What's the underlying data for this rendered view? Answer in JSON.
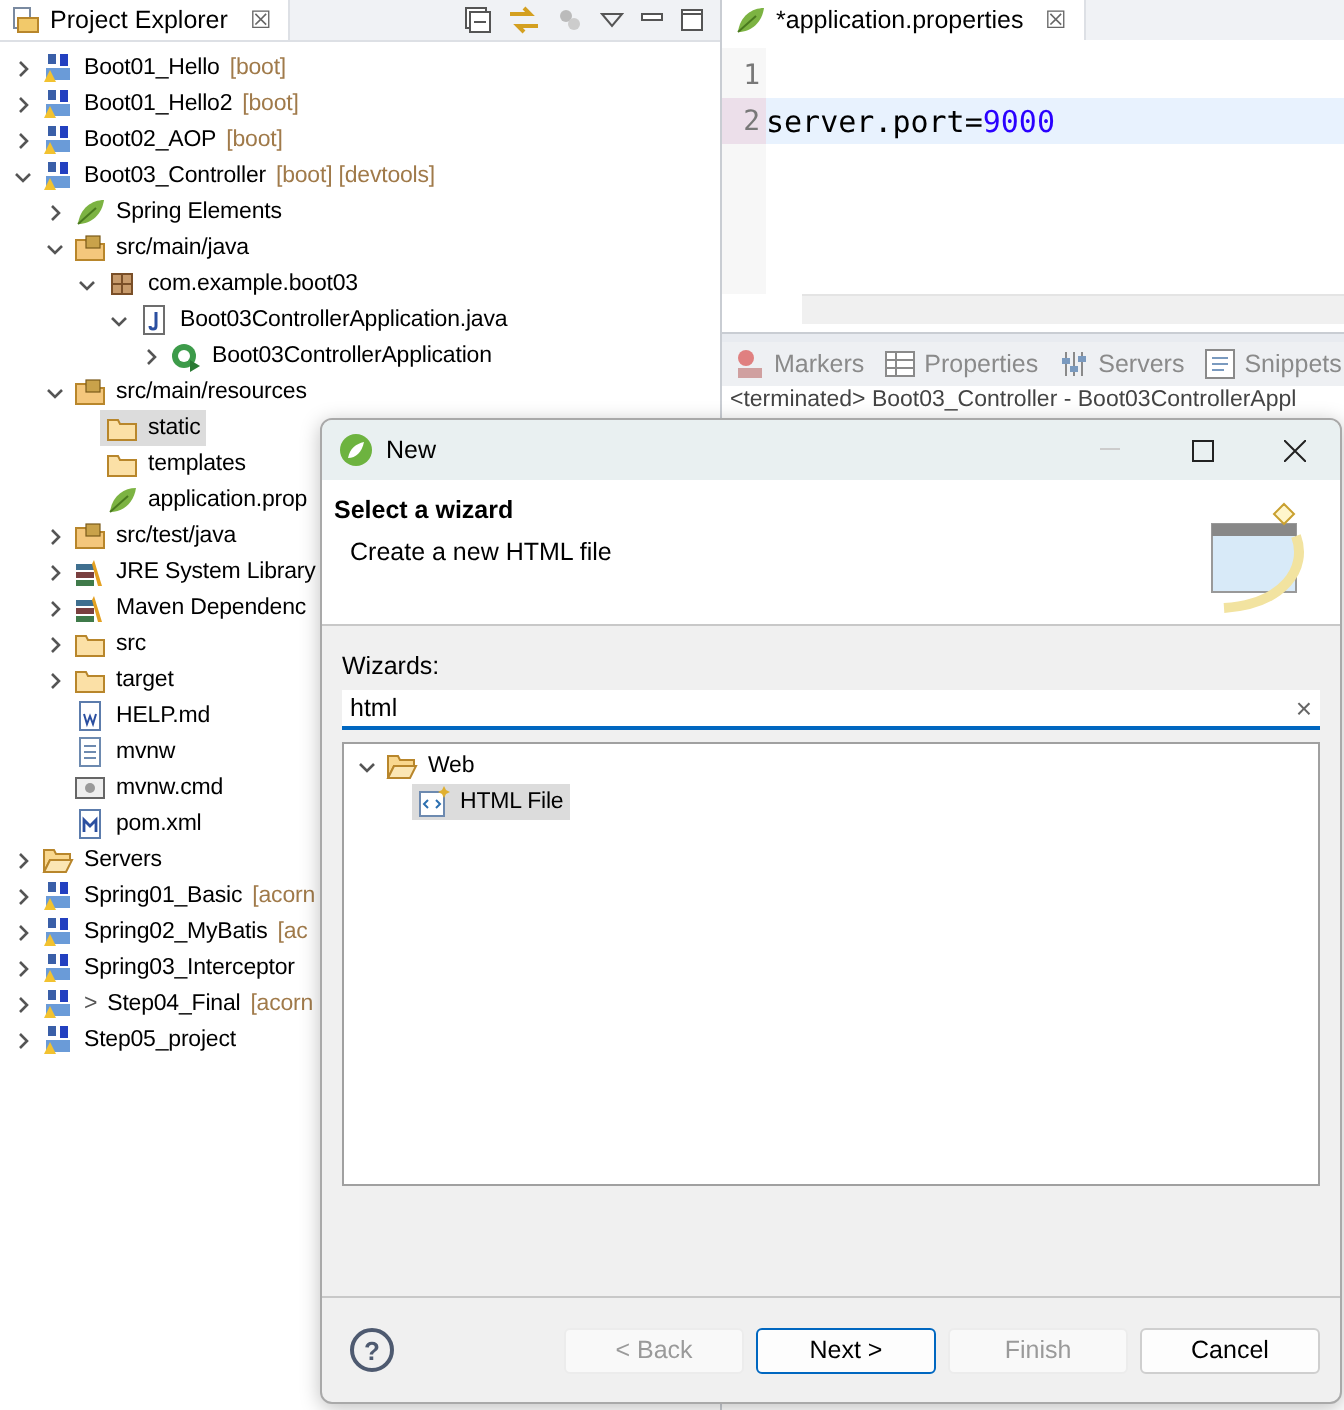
{
  "explorer": {
    "title": "Project Explorer",
    "close": "☒",
    "tree": [
      {
        "label": "Boot01_Hello",
        "tag": "[boot]",
        "kind": "project",
        "expanded": false,
        "selected": false
      },
      {
        "label": "Boot01_Hello2",
        "tag": "[boot]",
        "kind": "project",
        "expanded": false,
        "selected": false
      },
      {
        "label": "Boot02_AOP",
        "tag": "[boot]",
        "kind": "project",
        "expanded": false,
        "selected": false
      },
      {
        "label": "Boot03_Controller",
        "tag": "[boot] [devtools]",
        "kind": "project",
        "expanded": true,
        "selected": false,
        "children": [
          {
            "label": "Spring Elements",
            "kind": "spring",
            "expanded": false,
            "selected": false
          },
          {
            "label": "src/main/java",
            "kind": "srcfolder",
            "expanded": true,
            "selected": false,
            "children": [
              {
                "label": "com.example.boot03",
                "kind": "package",
                "expanded": true,
                "selected": false,
                "children": [
                  {
                    "label": "Boot03ControllerApplication.java",
                    "kind": "javafile",
                    "expanded": true,
                    "selected": false,
                    "children": [
                      {
                        "label": "Boot03ControllerApplication",
                        "kind": "class",
                        "expanded": false,
                        "selected": false
                      }
                    ]
                  }
                ]
              }
            ]
          },
          {
            "label": "src/main/resources",
            "kind": "srcfolder",
            "expanded": true,
            "selected": false,
            "children": [
              {
                "label": "static",
                "kind": "folder",
                "selected": true
              },
              {
                "label": "templates",
                "kind": "folder",
                "selected": false
              },
              {
                "label": "application.prop",
                "kind": "spring",
                "selected": false
              }
            ]
          },
          {
            "label": "src/test/java",
            "kind": "srcfolder",
            "expanded": false,
            "selected": false
          },
          {
            "label": "JRE System Library",
            "kind": "library",
            "expanded": false,
            "selected": false
          },
          {
            "label": "Maven Dependenc",
            "kind": "library",
            "expanded": false,
            "selected": false
          },
          {
            "label": "src",
            "kind": "folder",
            "expanded": false,
            "selected": false
          },
          {
            "label": "target",
            "kind": "folder",
            "expanded": false,
            "selected": false
          },
          {
            "label": "HELP.md",
            "kind": "docfile",
            "selected": false
          },
          {
            "label": "mvnw",
            "kind": "textfile",
            "selected": false
          },
          {
            "label": "mvnw.cmd",
            "kind": "cmdfile",
            "selected": false
          },
          {
            "label": "pom.xml",
            "kind": "mavenfile",
            "selected": false
          }
        ]
      },
      {
        "label": "Servers",
        "kind": "openfolder",
        "expanded": false,
        "selected": false
      },
      {
        "label": "Spring01_Basic",
        "tag": "[acorn",
        "kind": "project",
        "expanded": false,
        "selected": false
      },
      {
        "label": "Spring02_MyBatis",
        "tag": "[ac",
        "kind": "project",
        "expanded": false,
        "selected": false
      },
      {
        "label": "Spring03_Interceptor",
        "kind": "project",
        "expanded": false,
        "selected": false
      },
      {
        "label": "Step04_Final",
        "prefix": ">",
        "tag": "[acorn",
        "kind": "project",
        "expanded": false,
        "selected": false
      },
      {
        "label": "Step05_project",
        "kind": "project",
        "expanded": false,
        "selected": false
      }
    ]
  },
  "editor": {
    "tab": "*application.properties",
    "close": "☒",
    "lines": [
      {
        "number": "1",
        "current": false
      },
      {
        "number": "2",
        "current": true,
        "tokens": [
          {
            "text": "server.port=",
            "kind": "plain"
          },
          {
            "text": "9000",
            "kind": "number"
          }
        ]
      }
    ]
  },
  "console": {
    "tabs": [
      {
        "label": "Markers",
        "kind": "markers",
        "selected": false
      },
      {
        "label": "Properties",
        "kind": "properties",
        "selected": false
      },
      {
        "label": "Servers",
        "kind": "servers",
        "selected": false
      },
      {
        "label": "Snippets",
        "kind": "snippets",
        "selected": false
      }
    ],
    "line": "<terminated> Boot03_Controller - Boot03ControllerAppl"
  },
  "dialog": {
    "title": "New",
    "heading": "Select a wizard",
    "description": "Create a new HTML file",
    "label": "Wizards:",
    "filter": "html",
    "clear": "×",
    "help": "?",
    "tree": [
      {
        "label": "Web",
        "kind": "openfolder",
        "expanded": true,
        "selected": false,
        "children": [
          {
            "label": "HTML File",
            "kind": "htmlfile",
            "selected": true
          }
        ]
      }
    ],
    "buttons": [
      {
        "label": "< Back",
        "disabled": true,
        "default": false
      },
      {
        "label": "Next >",
        "disabled": false,
        "default": true
      },
      {
        "label": "Finish",
        "disabled": true,
        "default": false
      },
      {
        "label": "Cancel",
        "disabled": false,
        "default": false
      }
    ]
  }
}
